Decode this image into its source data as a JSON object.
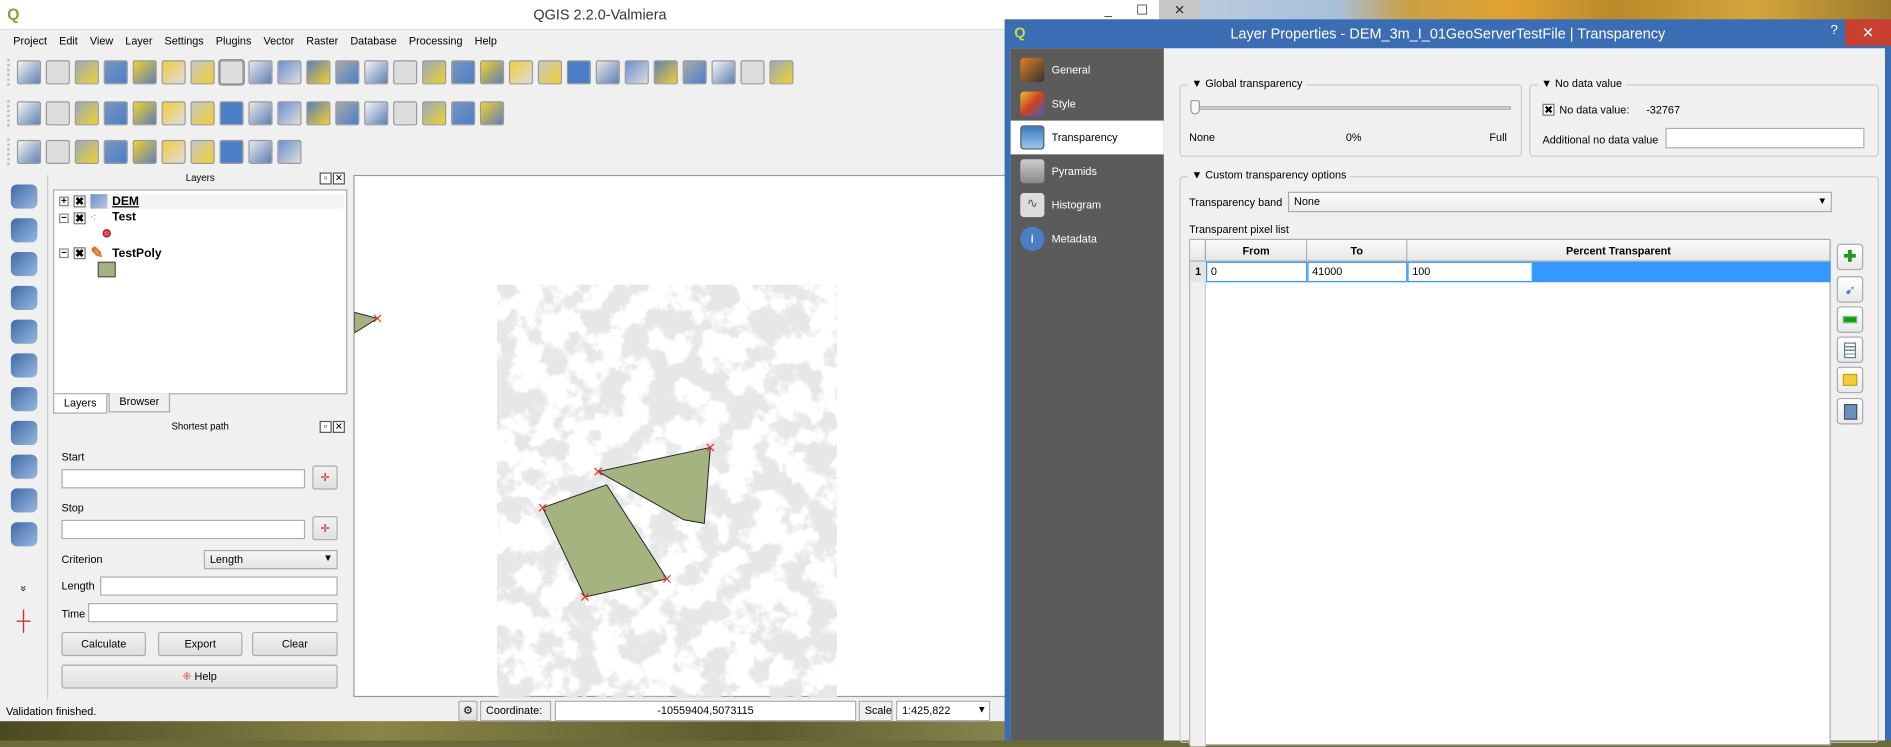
{
  "main_window": {
    "title": "QGIS 2.2.0-Valmiera",
    "controls": {
      "minimize": "_",
      "maximize": "☐",
      "close": "✕"
    },
    "menu": [
      "Project",
      "Edit",
      "View",
      "Layer",
      "Settings",
      "Plugins",
      "Vector",
      "Raster",
      "Database",
      "Processing",
      "Help"
    ],
    "toolbar1": [
      "new-project",
      "open-project",
      "save-project",
      "save-as",
      "new-print-composer",
      "composer-manager",
      "touch-zoom",
      "pan",
      "pan-to-selection",
      "zoom-in",
      "zoom-out",
      "zoom-native",
      "zoom-full",
      "zoom-to-selection",
      "zoom-to-layer",
      "zoom-last",
      "zoom-next",
      "refresh",
      "identify",
      "action",
      "select",
      "deselect",
      "expression-select",
      "attribute-table",
      "statistics",
      "measure",
      "annotation"
    ],
    "toolbar2": [
      "toggle-editing",
      "current-edits",
      "save-edits",
      "add-feature",
      "move-feature",
      "node-tool",
      "delete-selected",
      "cut-features",
      "copy-features",
      "paste-features",
      "label",
      "layer-labeling",
      "pin-labels",
      "show-hide-labels",
      "move-label",
      "rotate-label",
      "change-label"
    ],
    "toolbar3": [
      "add-delimited-layer",
      "new-spatialite-layer",
      "new-gpx-layer",
      "digitize-vector",
      "digitize-raster",
      "vector-tool",
      "vector-edit",
      "georeferencer",
      "composer-1",
      "composer-2"
    ],
    "left_toolbar": [
      "add-vector-layer",
      "add-raster-layer",
      "add-postgis-layer",
      "add-spatialite-layer",
      "add-mssql-layer",
      "add-oracle-layer",
      "add-sql-raster-layer",
      "add-wms-layer",
      "add-wcs-layer",
      "add-wfs-layer",
      "add-delimited-text-layer"
    ],
    "left_toolbar_more": "»",
    "capture_tool_icon": "crosshair"
  },
  "layers_panel": {
    "title": "Layers",
    "layers": [
      {
        "name": "DEM",
        "checked": true,
        "expanded": false
      },
      {
        "name": "Test",
        "checked": true,
        "expanded": true
      },
      {
        "name": "TestPoly",
        "checked": true,
        "expanded": true
      }
    ],
    "tabs": [
      "Layers",
      "Browser"
    ],
    "active_tab": "Layers"
  },
  "shortest_path": {
    "title": "Shortest path",
    "start_label": "Start",
    "start_value": "",
    "stop_label": "Stop",
    "stop_value": "",
    "criterion_label": "Criterion",
    "criterion_value": "Length",
    "length_label": "Length",
    "length_value": "",
    "time_label": "Time",
    "time_value": "",
    "calculate": "Calculate",
    "export": "Export",
    "clear": "Clear",
    "help": "Help"
  },
  "status_bar": {
    "message": "Validation finished.",
    "coordinate_label": "Coordinate:",
    "coordinate_value": "-10559404,5073115",
    "scale_label": "Scale",
    "scale_value": "1:425,822"
  },
  "colors": {
    "polygon_fill": "#a5b381",
    "dialog_title": "#3b6db4",
    "selection": "#3399ff",
    "sidebar": "#5b5b5b"
  },
  "dialog": {
    "title": "Layer Properties - DEM_3m_I_01GeoServerTestFile | Transparency",
    "help": "?",
    "close": "✕",
    "sidebar": [
      {
        "label": "General",
        "icon": "tools"
      },
      {
        "label": "Style",
        "icon": "paintbrush"
      },
      {
        "label": "Transparency",
        "icon": "monitor",
        "selected": true
      },
      {
        "label": "Pyramids",
        "icon": "pyramid"
      },
      {
        "label": "Histogram",
        "icon": "histogram"
      },
      {
        "label": "Metadata",
        "icon": "info"
      }
    ],
    "global_transparency": {
      "title": "Global transparency",
      "value_percent": 0,
      "min_label": "None",
      "value_label": "0%",
      "max_label": "Full"
    },
    "no_data": {
      "title": "No data value",
      "checkbox_label": "No data value:",
      "checked": true,
      "value": "-32767",
      "additional_label": "Additional no data value",
      "additional_value": ""
    },
    "custom": {
      "title": "Custom transparency options",
      "band_label": "Transparency band",
      "band_value": "None",
      "list_label": "Transparent pixel list",
      "columns": [
        "From",
        "To",
        "Percent Transparent"
      ],
      "rows": [
        {
          "index": "1",
          "from": "0",
          "to": "41000",
          "percent": "100"
        }
      ],
      "buttons": [
        "add-value",
        "add-from-display",
        "remove-value",
        "default-values",
        "import-from-file",
        "export-to-file"
      ]
    }
  }
}
